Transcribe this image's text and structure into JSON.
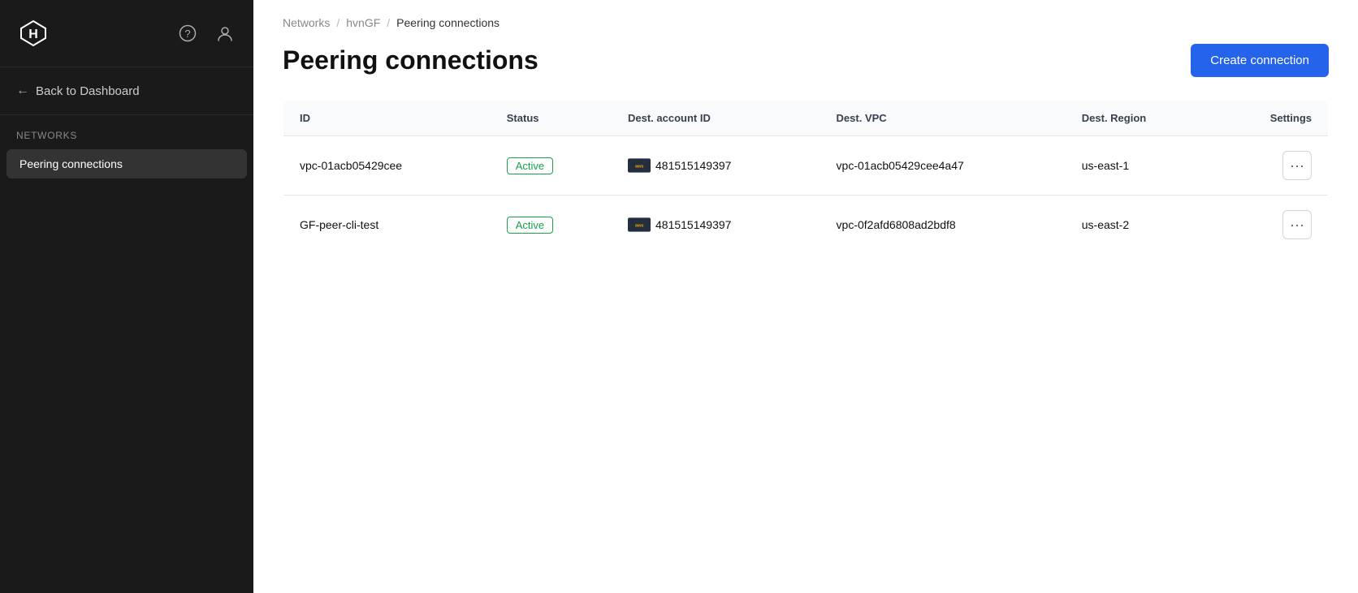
{
  "sidebar": {
    "logo_alt": "HashiCorp logo",
    "back_label": "Back to Dashboard",
    "section_label": "Networks",
    "nav_items": [
      {
        "id": "peering-connections",
        "label": "Peering connections",
        "active": true
      }
    ],
    "help_icon": "?",
    "user_icon": "👤"
  },
  "breadcrumb": {
    "items": [
      {
        "id": "networks",
        "label": "Networks",
        "current": false
      },
      {
        "id": "hvngf",
        "label": "hvnGF",
        "current": false
      },
      {
        "id": "peering-connections",
        "label": "Peering connections",
        "current": true
      }
    ],
    "separator": "/"
  },
  "page": {
    "title": "Peering connections",
    "create_button_label": "Create connection"
  },
  "table": {
    "columns": [
      {
        "id": "id",
        "label": "ID"
      },
      {
        "id": "status",
        "label": "Status"
      },
      {
        "id": "dest_account_id",
        "label": "Dest. account ID"
      },
      {
        "id": "dest_vpc",
        "label": "Dest. VPC"
      },
      {
        "id": "dest_region",
        "label": "Dest. Region"
      },
      {
        "id": "settings",
        "label": "Settings"
      }
    ],
    "rows": [
      {
        "id": "vpc-01acb05429cee",
        "status": "Active",
        "dest_account_id": "481515149397",
        "dest_vpc": "vpc-01acb05429cee4a47",
        "dest_region": "us-east-1"
      },
      {
        "id": "GF-peer-cli-test",
        "status": "Active",
        "dest_account_id": "481515149397",
        "dest_vpc": "vpc-0f2afd6808ad2bdf8",
        "dest_region": "us-east-2"
      }
    ]
  }
}
